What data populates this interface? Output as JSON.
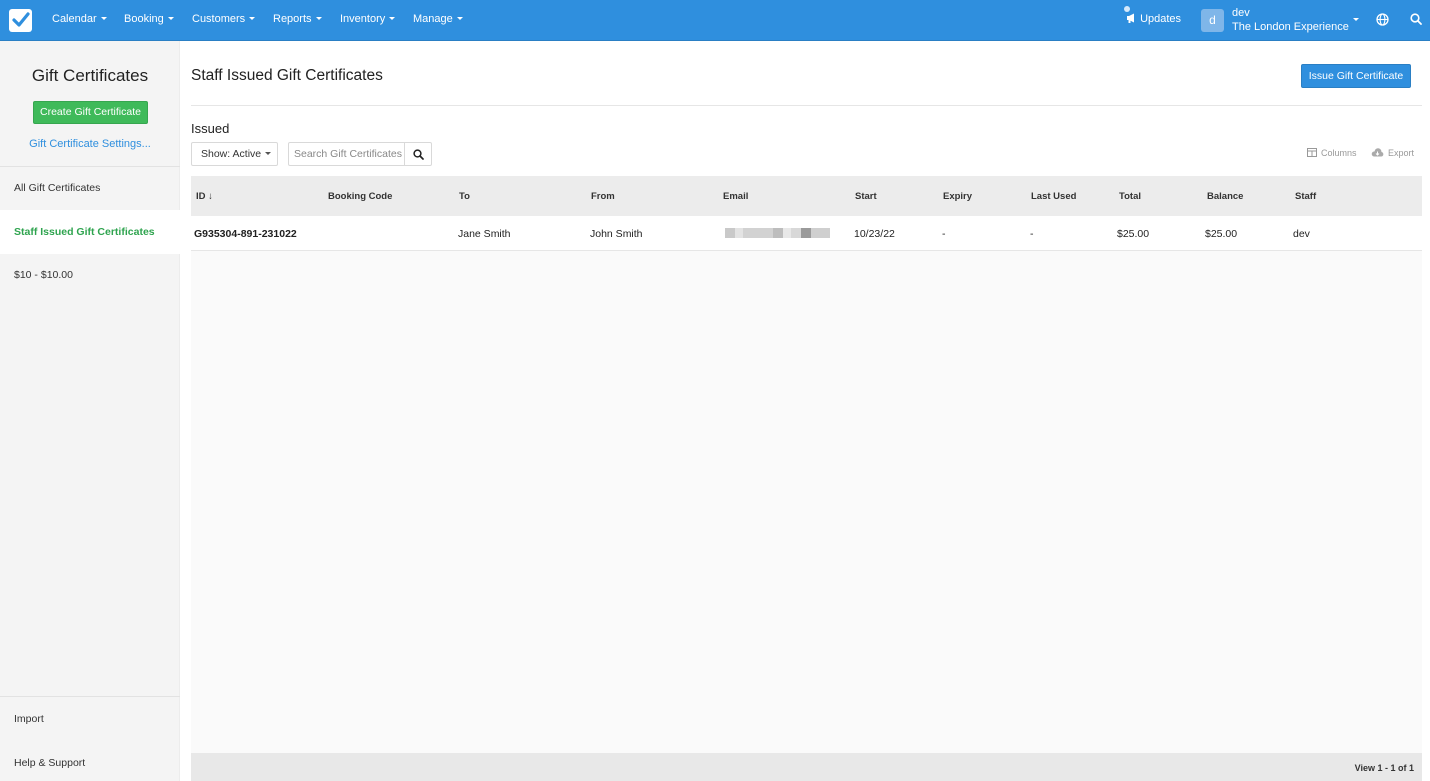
{
  "nav": {
    "items": [
      "Calendar",
      "Booking",
      "Customers",
      "Reports",
      "Inventory",
      "Manage"
    ],
    "updates_label": "Updates",
    "user_initial": "d",
    "user_name": "dev",
    "user_org": "The London Experience"
  },
  "sidebar": {
    "title": "Gift Certificates",
    "create_button": "Create Gift Certificate",
    "settings_link": "Gift Certificate Settings...",
    "items": [
      "All Gift Certificates",
      "Staff Issued Gift Certificates",
      "$10 - $10.00"
    ],
    "active_index": 1,
    "bottom_items": [
      "Import",
      "Help & Support"
    ]
  },
  "main": {
    "title": "Staff Issued Gift Certificates",
    "issue_button": "Issue Gift Certificate",
    "section_title": "Issued",
    "show_filter": "Show: Active",
    "search_placeholder": "Search Gift Certificates",
    "columns_label": "Columns",
    "export_label": "Export"
  },
  "table": {
    "headers": [
      "ID ↓",
      "Booking Code",
      "To",
      "From",
      "Email",
      "Start",
      "Expiry",
      "Last Used",
      "Total",
      "Balance",
      "Staff"
    ],
    "rows": [
      {
        "id": "G935304-891-231022",
        "booking_code": "",
        "to": "Jane Smith",
        "from": "John Smith",
        "email": "",
        "start": "10/23/22",
        "expiry": "-",
        "last_used": "-",
        "total": "$25.00",
        "balance": "$25.00",
        "staff": "dev"
      }
    ],
    "pager": "View 1 - 1 of 1"
  },
  "colors": {
    "topbar": "#2f8fde",
    "create_green": "#3fba5a",
    "active_green": "#2fa44f"
  }
}
